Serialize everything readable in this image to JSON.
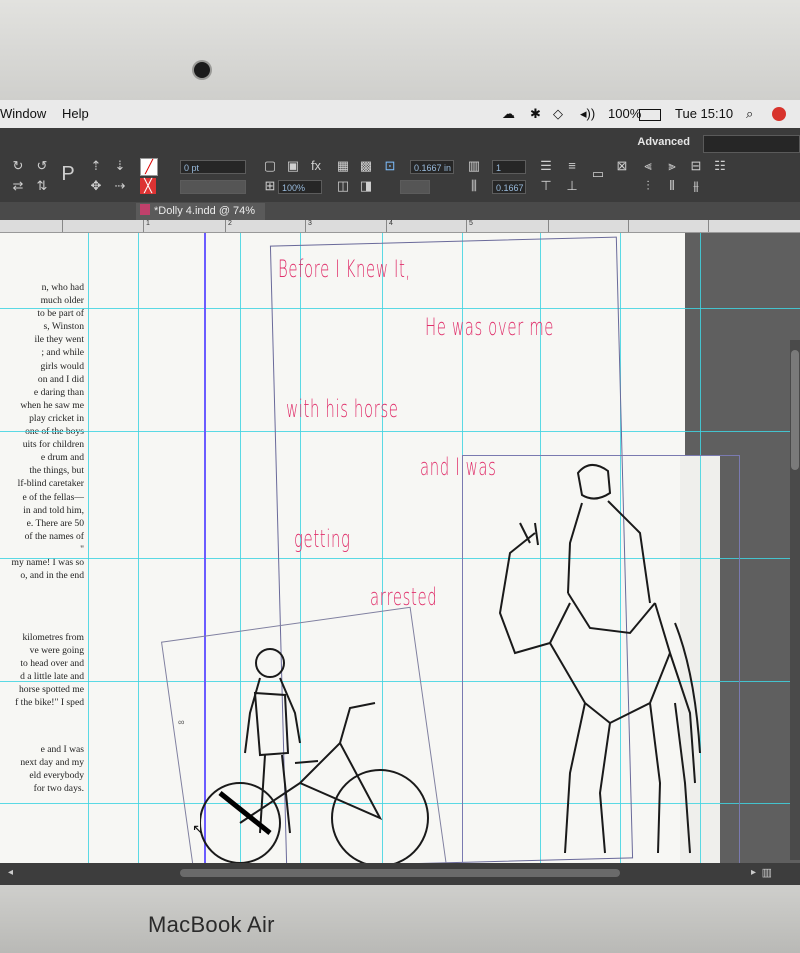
{
  "menubar": {
    "items": [
      "Window",
      "Help"
    ],
    "battery_percent": "100%",
    "clock": "Tue 15:10"
  },
  "controlbar": {
    "stroke_weight": "0 pt",
    "scale": "100%",
    "offset": "0.1667 in",
    "columns": "1",
    "gutter": "0.1667",
    "workspace": "Advanced"
  },
  "document": {
    "tab_title": "*Dolly 4.indd @ 74%"
  },
  "ruler": {
    "labels": [
      "1",
      "2",
      "3",
      "4",
      "5"
    ]
  },
  "page_text": {
    "column1": [
      "n, who had",
      "much older",
      "to be part of",
      "s, Winston",
      "ile they went",
      "; and while",
      "girls would",
      "on and I did",
      "e daring than",
      "when he saw me",
      "play cricket in",
      "one of the boys",
      "uits for children",
      "e drum and",
      "the things, but",
      "lf-blind caretaker",
      "e of the fellas—",
      "in and told him,",
      "e. There are 50",
      "of the names of",
      "\"",
      "my name! I was so",
      "o, and in the end"
    ],
    "column2": [
      "kilometres from",
      "ve were going",
      "to head over and",
      "d a little late and",
      "horse spotted me",
      "f the bike!\" I sped"
    ],
    "column3": [
      "e and I was",
      "next day and my",
      "eld everybody",
      "for two days."
    ]
  },
  "poem_lines": [
    "Before I Knew It,",
    "He was over me",
    "with his horse",
    "and I was",
    "getting",
    "arrested"
  ],
  "device": {
    "brand": "MacBook Air"
  },
  "colors": {
    "poem": "#e0306b",
    "guide": "#3fd3e0",
    "gutter": "#6b5cff"
  }
}
